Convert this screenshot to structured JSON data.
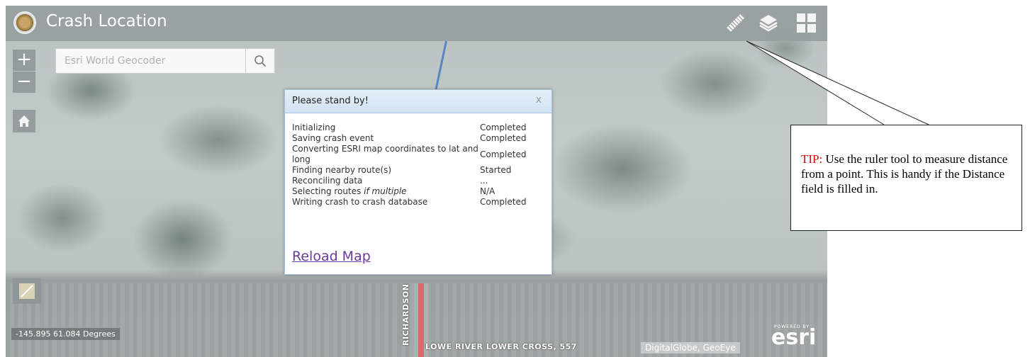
{
  "header": {
    "title": "Crash Location"
  },
  "search": {
    "placeholder": "Esri World Geocoder"
  },
  "map_controls": {
    "zoom_in": "+",
    "zoom_out": "−"
  },
  "dialog": {
    "title": "Please stand by!",
    "close": "x",
    "rows": [
      {
        "label": "Initializing",
        "label_em": "",
        "status": "Completed"
      },
      {
        "label": "Saving crash event",
        "label_em": "",
        "status": "Completed"
      },
      {
        "label": "Converting ESRI map coordinates to lat and long",
        "label_em": "",
        "status": "Completed"
      },
      {
        "label": "Finding nearby route(s)",
        "label_em": "",
        "status": "Started"
      },
      {
        "label": "Reconciling data",
        "label_em": "",
        "status": "..."
      },
      {
        "label": "Selecting routes ",
        "label_em": "if multiple",
        "status": "N/A"
      },
      {
        "label": "Writing crash to crash database",
        "label_em": "",
        "status": "Completed"
      }
    ],
    "reload_link": "Reload Map"
  },
  "map_labels": {
    "coordinates": "-145.895 61.084 Degrees",
    "road_vertical": "RICHARDSON",
    "road_horizontal": "LOWE RIVER LOWER CROSS, 557",
    "attribution": "DigitalGlobe, GeoEye",
    "powered_by": "POWERED BY",
    "esri": "esri"
  },
  "tip": {
    "prefix": "TIP:",
    "text": "  Use the ruler tool to measure distance from a point. This is handy if the Distance field is filled in."
  },
  "colors": {
    "tip_prefix": "#e00000",
    "reload_link": "#6a3a9a",
    "dialog_header": "#d2e3f3"
  }
}
